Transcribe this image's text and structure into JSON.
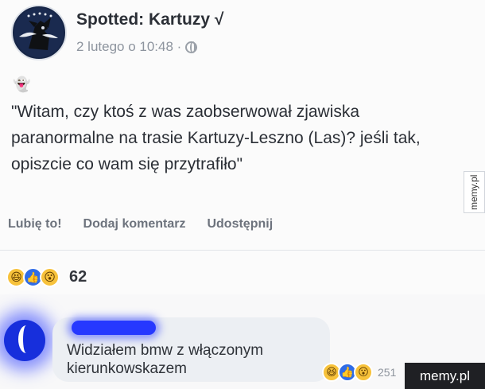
{
  "post": {
    "page_name": "Spotted: Kartuzy √",
    "timestamp": "2 lutego o 10:48 ·",
    "emoji_icon": "ghost-icon",
    "text": "\"Witam, czy ktoś z was zaobserwował zjawiska paranormalne na trasie Kartuzy-Leszno (Las)? jeśli tak, opiszcie co wam się przytrafiło\"",
    "actions": [
      "Lubię to!",
      "Dodaj komentarz",
      "Udostępnij"
    ],
    "reaction_count": "62"
  },
  "comment": {
    "text": "Widziałem bmw z włączonym kierunkowskazem",
    "reaction_count": "251"
  },
  "watermark": "memy.pl",
  "colors": {
    "accent": "#2f6ce7",
    "highlight": "#2638ff"
  }
}
